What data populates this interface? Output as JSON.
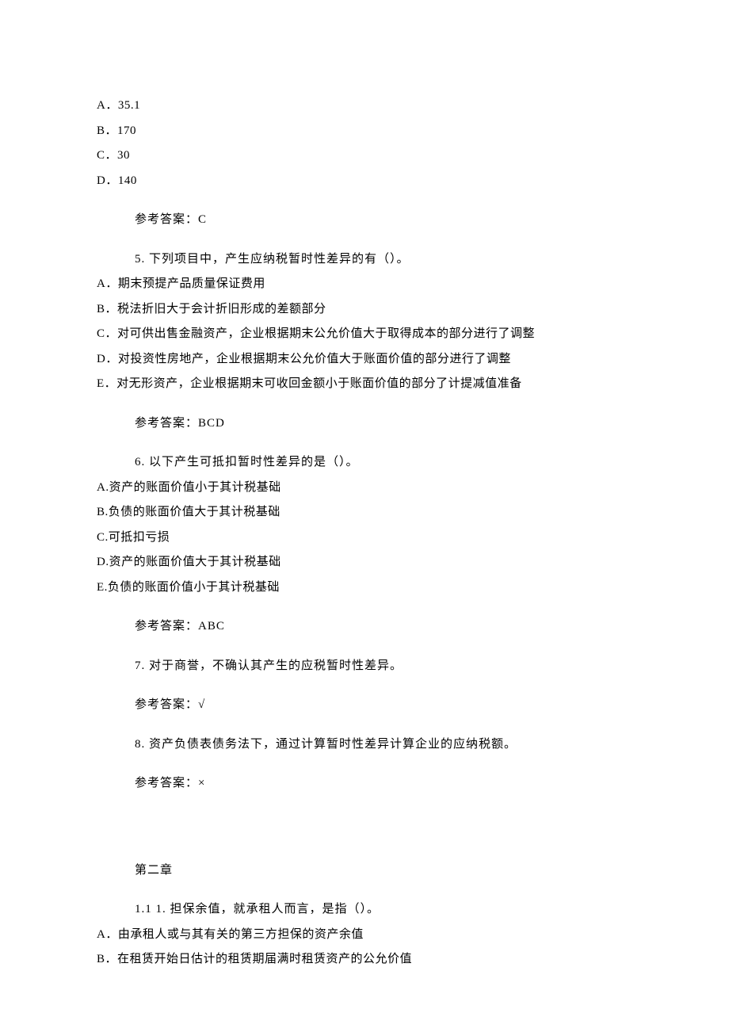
{
  "q4": {
    "options": {
      "A": "A．35.1",
      "B": "B．170",
      "C": "C．30",
      "D": "D．140"
    },
    "answer": "参考答案：C"
  },
  "q5": {
    "stem": "5.   下列项目中，产生应纳税暂时性差异的有（）。",
    "options": {
      "A": "A．期末预提产品质量保证费用",
      "B": "B．税法折旧大于会计折旧形成的差额部分",
      "C": "C．对可供出售金融资产，企业根据期末公允价值大于取得成本的部分进行了调整",
      "D": "D．对投资性房地产，企业根据期末公允价值大于账面价值的部分进行了调整",
      "E": "E．对无形资产，企业根据期末可收回金额小于账面价值的部分了计提减值准备"
    },
    "answer": "参考答案：BCD"
  },
  "q6": {
    "stem": "6.   以下产生可抵扣暂时性差异的是（）。",
    "options": {
      "A": "A.资产的账面价值小于其计税基础",
      "B": "B.负债的账面价值大于其计税基础",
      "C": "C.可抵扣亏损",
      "D": "D.资产的账面价值大于其计税基础",
      "E": "E.负债的账面价值小于其计税基础"
    },
    "answer": "参考答案：ABC"
  },
  "q7": {
    "stem": "7.   对于商誉，不确认其产生的应税暂时性差异。",
    "answer": "参考答案：√"
  },
  "q8": {
    "stem": "8.   资产负债表债务法下，通过计算暂时性差异计算企业的应纳税额。",
    "answer": "参考答案：×"
  },
  "chapter2": {
    "title": "第二章",
    "q1": {
      "stem": "1.1 1.   担保余值，就承租人而言，是指（）。",
      "options": {
        "A": "A．由承租人或与其有关的第三方担保的资产余值",
        "B": "B．在租赁开始日估计的租赁期届满时租赁资产的公允价值"
      }
    }
  }
}
